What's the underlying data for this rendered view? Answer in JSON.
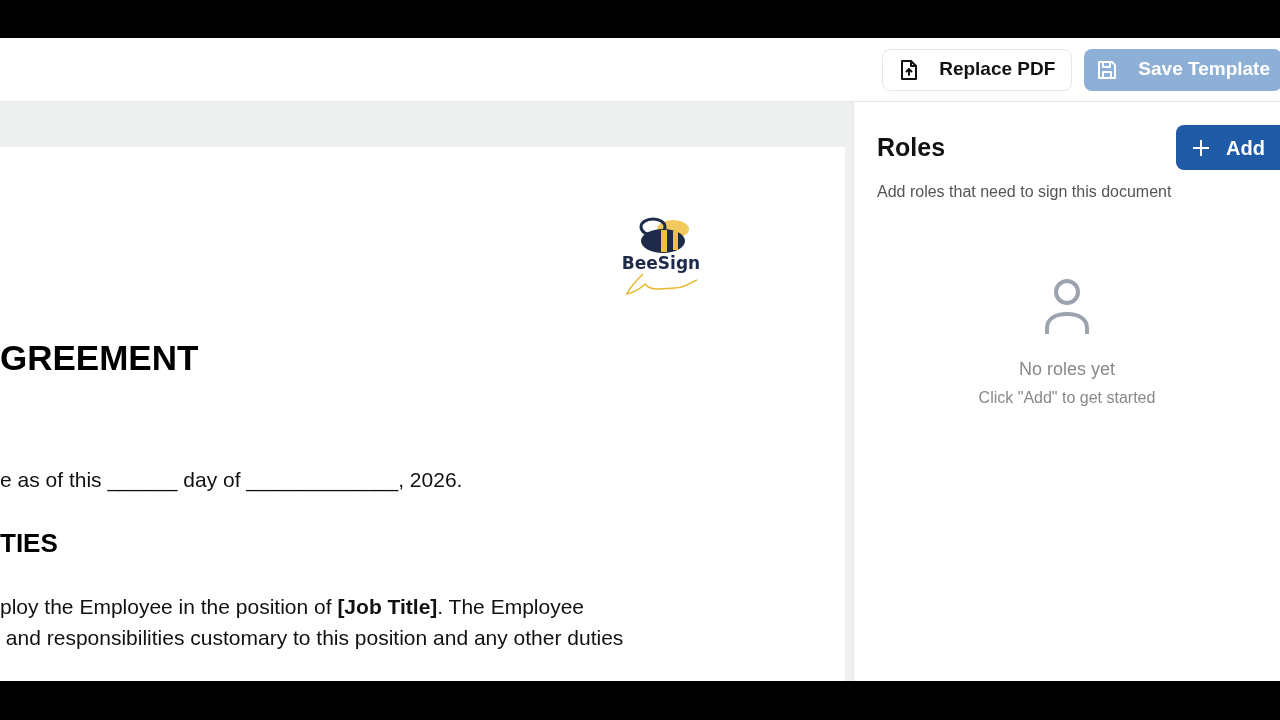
{
  "toolbar": {
    "buttons": [
      {
        "label": "Replace PDF",
        "kind": "upload",
        "disabled": false
      },
      {
        "label": "Save Template",
        "kind": "save",
        "disabled": true
      }
    ]
  },
  "document": {
    "logo_text": "BeeSign",
    "heading": "GREEMENT",
    "date_line": "e as of this ______ day of _____________, 2026.",
    "section_heading": "TIES",
    "paragraph_lines": [
      "ploy the Employee in the position of **[Job Title]**. The Employee",
      " and responsibilities customary to this position and any other duties"
    ]
  },
  "roles_panel": {
    "title": "Roles",
    "add_button": "Add",
    "description": "Add roles that need to sign this document",
    "empty_title": "No roles yet",
    "empty_hint": "Click \"Add\" to get started"
  }
}
